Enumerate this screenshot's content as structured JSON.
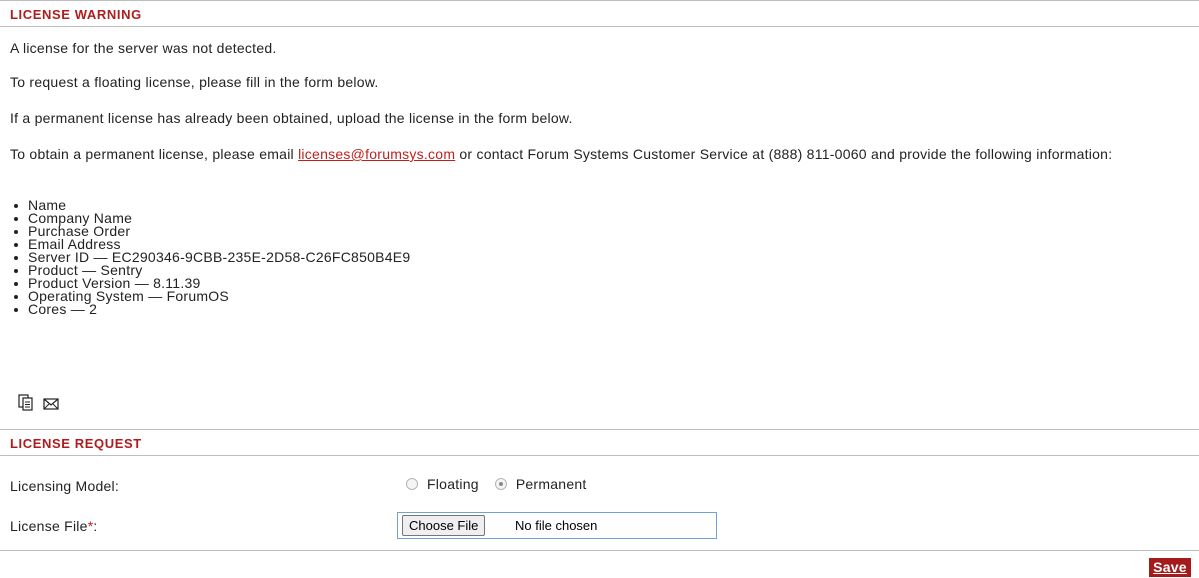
{
  "warning": {
    "title": "LICENSE WARNING",
    "line1": "A license for the server was not detected.",
    "line2": "To request a floating license, please fill in the form below.",
    "line3": "If a permanent license has already been obtained, upload the license in the form below.",
    "line4_prefix": "To obtain a permanent license, please email ",
    "line4_link": "licenses@forumsys.com",
    "line4_suffix": " or contact Forum Systems Customer Service at (888) 811-0060 and provide the following information:",
    "items": [
      "Name",
      "Company Name",
      "Purchase Order",
      "Email Address",
      "Server ID — EC290346-9CBB-235E-2D58-C26FC850B4E9",
      "Product — Sentry",
      "Product Version — 8.11.39",
      "Operating System — ForumOS",
      "Cores — 2"
    ],
    "icons": [
      "copy-icon",
      "email-icon"
    ]
  },
  "request": {
    "title": "LICENSE REQUEST",
    "licensing_model_label": "Licensing Model:",
    "options": [
      "Floating",
      "Permanent"
    ],
    "selected_option": "Permanent",
    "license_file_label": "License File",
    "required_mark": "*",
    "label_colon": ":",
    "choose_file_label": "Choose File",
    "file_status": "No file chosen"
  },
  "actions": {
    "save_label": "Save"
  },
  "colors": {
    "accent": "#b01c1c",
    "button_bg": "#a51b1b",
    "link": "#c0201c"
  }
}
